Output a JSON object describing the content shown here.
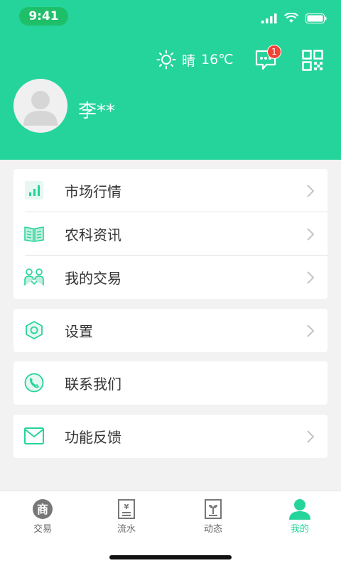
{
  "status": {
    "time": "9:41"
  },
  "weather": {
    "condition": "晴",
    "temp": "16℃"
  },
  "header": {
    "message_badge": "1",
    "username": "李**"
  },
  "menu_groups": [
    [
      {
        "label": "市场行情",
        "icon": "bar-chart-icon",
        "chevron": true
      },
      {
        "label": "农科资讯",
        "icon": "open-book-icon",
        "chevron": true
      },
      {
        "label": "我的交易",
        "icon": "people-icon",
        "chevron": true
      }
    ],
    [
      {
        "label": "设置",
        "icon": "gear-icon",
        "chevron": true
      }
    ],
    [
      {
        "label": "联系我们",
        "icon": "phone-icon",
        "chevron": false
      }
    ],
    [
      {
        "label": "功能反馈",
        "icon": "mail-icon",
        "chevron": true
      }
    ]
  ],
  "tabs": [
    {
      "label": "交易",
      "icon": "shop-icon",
      "active": false
    },
    {
      "label": "流水",
      "icon": "ledger-icon",
      "active": false
    },
    {
      "label": "动态",
      "icon": "sprout-icon",
      "active": false
    },
    {
      "label": "我的",
      "icon": "user-icon",
      "active": true
    }
  ],
  "colors": {
    "accent": "#25d49b",
    "badge": "#f44336"
  }
}
